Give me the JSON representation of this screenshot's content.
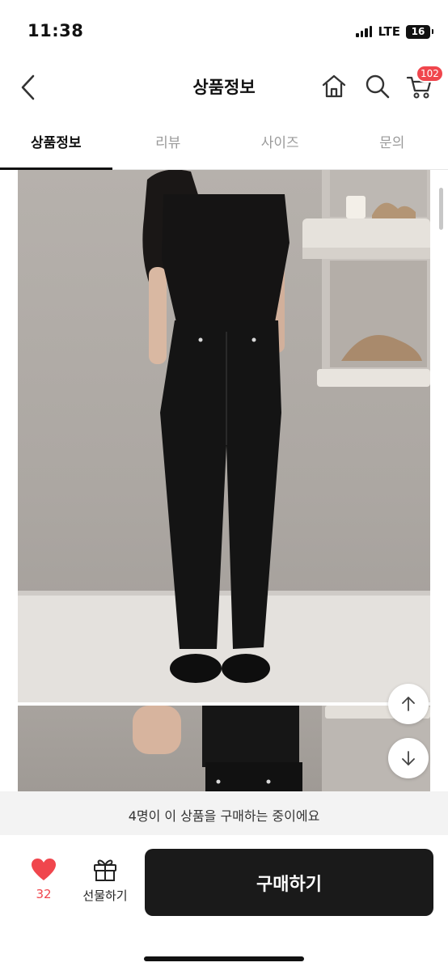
{
  "status": {
    "time": "11:38",
    "network": "LTE",
    "battery": "16"
  },
  "header": {
    "title": "상품정보",
    "cart_badge": "102"
  },
  "tabs": [
    {
      "label": "상품정보",
      "active": true
    },
    {
      "label": "리뷰",
      "active": false
    },
    {
      "label": "사이즈",
      "active": false
    },
    {
      "label": "문의",
      "active": false
    }
  ],
  "notice": {
    "text": "4명이 이 상품을 구매하는 중이에요"
  },
  "bottom_bar": {
    "like_count": "32",
    "gift_label": "선물하기",
    "buy_label": "구매하기"
  },
  "icons": {
    "back": "chevron-left-icon",
    "home": "home-icon",
    "search": "search-icon",
    "cart": "cart-icon",
    "scroll_up": "arrow-up-icon",
    "scroll_down": "arrow-down-icon",
    "like": "heart-icon",
    "gift": "gift-icon"
  },
  "colors": {
    "accent": "#f0464d",
    "buy_button": "#1a1a1a",
    "notice_bg": "#f3f3f3"
  }
}
